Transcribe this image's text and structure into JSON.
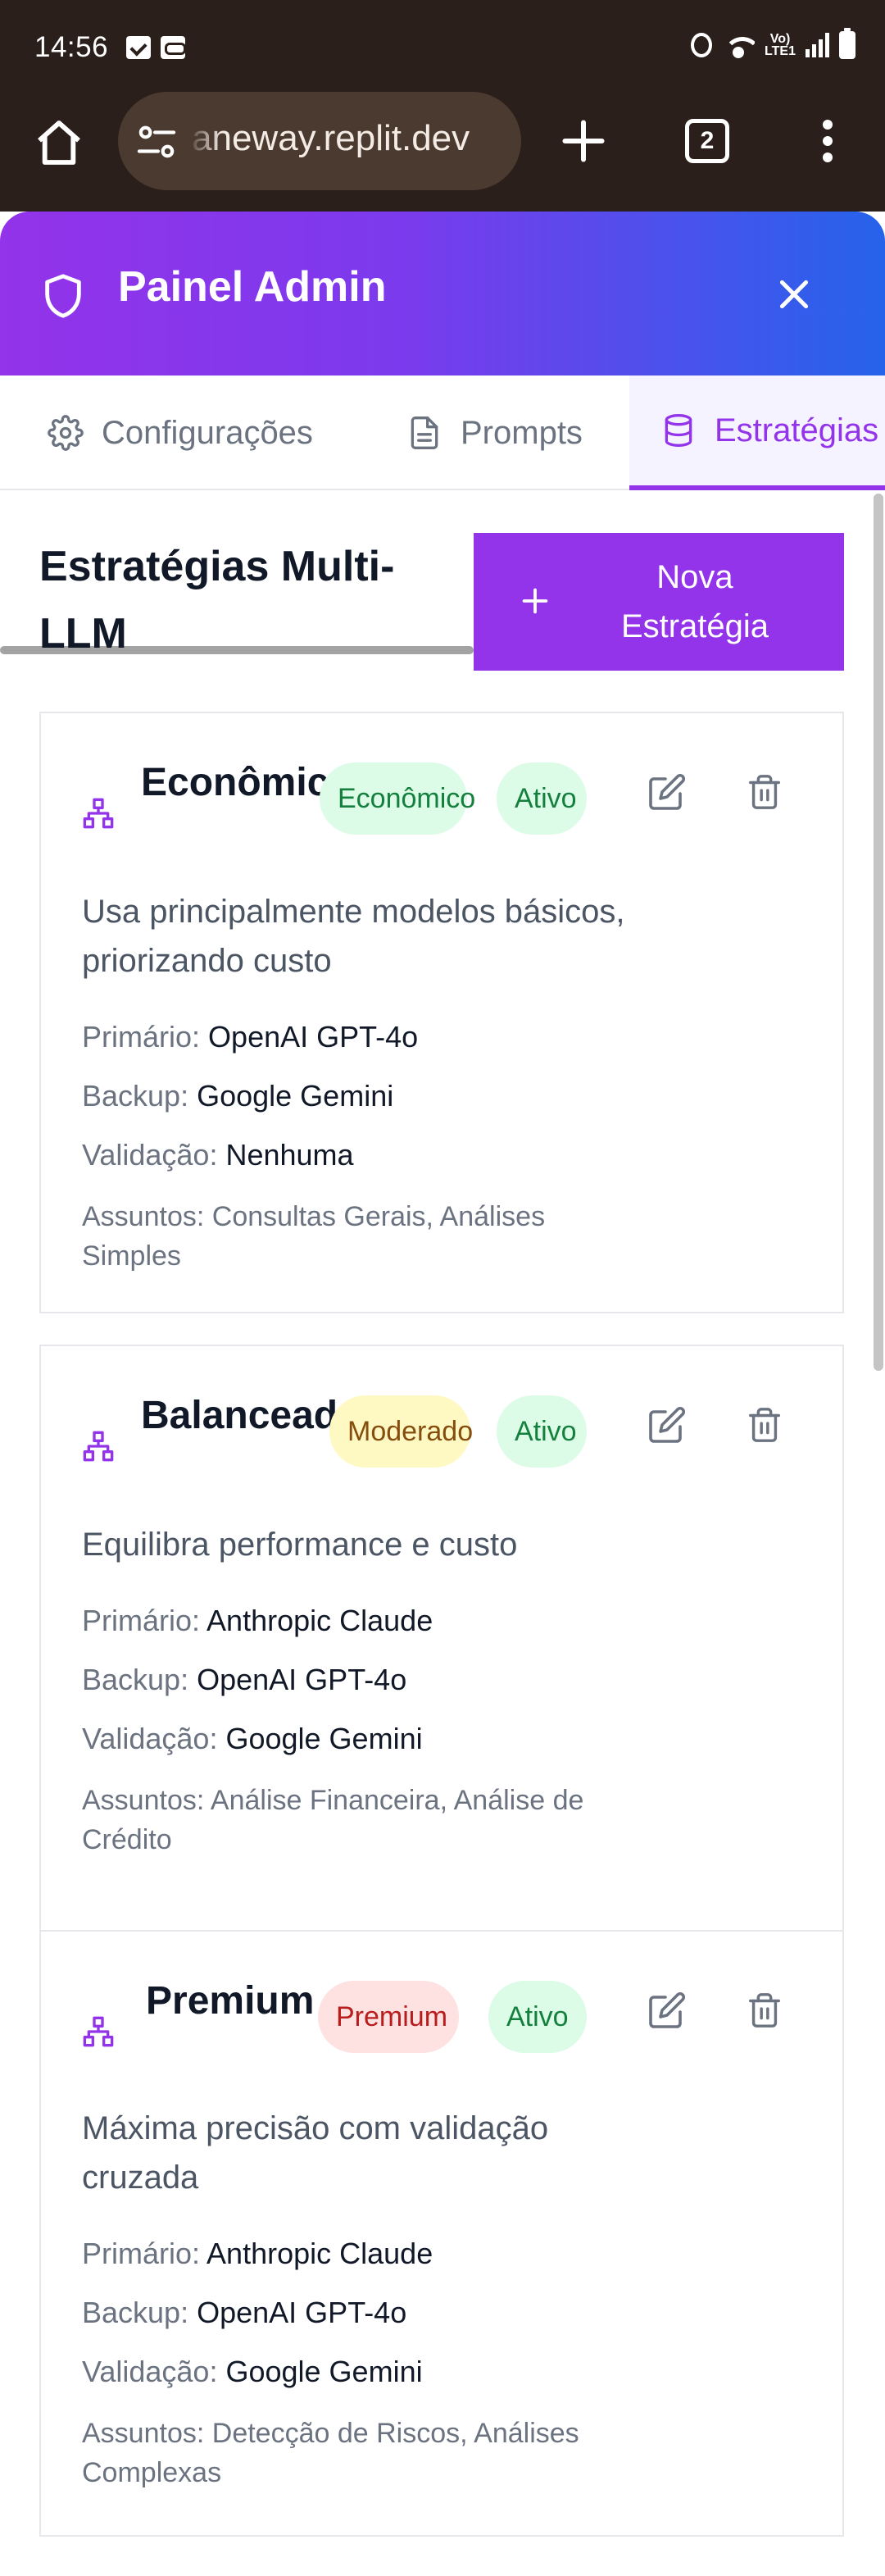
{
  "status_bar": {
    "time": "14:56",
    "network_label": "Vo) LTE1",
    "icons": [
      "check-box-icon",
      "voicemail-icon",
      "alarm-icon",
      "wifi-icon",
      "signal-icon",
      "battery-icon"
    ]
  },
  "browser": {
    "url": "aneway.replit.dev",
    "tab_count": "2",
    "icons": [
      "home-icon",
      "site-settings-icon",
      "new-tab-icon",
      "more-icon"
    ]
  },
  "panel": {
    "title": "Painel Admin",
    "colors": {
      "gradient_start": "#9333ea",
      "gradient_end": "#2563eb",
      "accent": "#9333ea"
    }
  },
  "tabs": [
    {
      "label": "Configurações",
      "icon": "gear-icon",
      "active": false
    },
    {
      "label": "Prompts",
      "icon": "document-icon",
      "active": false
    },
    {
      "label": "Estratégias",
      "icon": "database-icon",
      "active": true
    }
  ],
  "main": {
    "title": "Estratégias Multi-LLM",
    "new_button_label": "Nova Estratégia"
  },
  "labels": {
    "primary": "Primário:",
    "backup": "Backup:",
    "validation": "Validação:",
    "subjects": "Assuntos:"
  },
  "strategies": [
    {
      "name": "Econômico",
      "tier": "Econômico",
      "tier_color": "#dcfce7",
      "status": "Ativo",
      "description": "Usa principalmente modelos básicos, priorizando custo",
      "primary": "OpenAI GPT-4o",
      "backup": "Google Gemini",
      "validation": "Nenhuma",
      "subjects": "Consultas Gerais, Análises Simples"
    },
    {
      "name": "Balanceado",
      "tier": "Moderado",
      "tier_color": "#fef9c3",
      "status": "Ativo",
      "description": "Equilibra performance e custo",
      "primary": "Anthropic Claude",
      "backup": "OpenAI GPT-4o",
      "validation": "Google Gemini",
      "subjects": "Análise Financeira, Análise de Crédito"
    },
    {
      "name": "Premium",
      "tier": "Premium",
      "tier_color": "#fee2e2",
      "status": "Ativo",
      "description": "Máxima precisão com validação cruzada",
      "primary": "Anthropic Claude",
      "backup": "OpenAI GPT-4o",
      "validation": "Google Gemini",
      "subjects": "Detecção de Riscos, Análises Complexas"
    }
  ]
}
